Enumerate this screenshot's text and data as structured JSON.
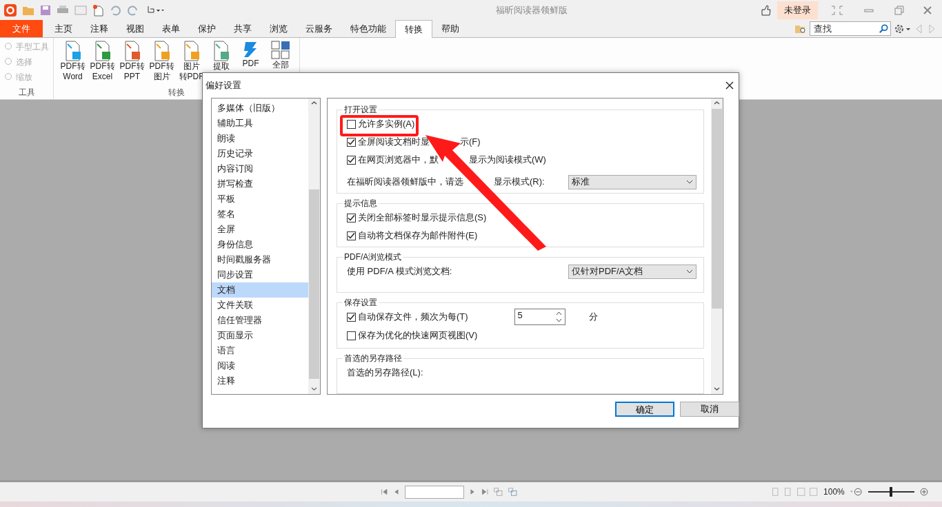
{
  "title_bar": {
    "title": "福昕阅读器领鲜版",
    "login": "未登录"
  },
  "menu_tabs": [
    {
      "label": "文件",
      "kind": "file",
      "selected": false
    },
    {
      "label": "主页",
      "kind": "tab",
      "selected": false
    },
    {
      "label": "注释",
      "kind": "tab",
      "selected": false
    },
    {
      "label": "视图",
      "kind": "tab",
      "selected": false
    },
    {
      "label": "表单",
      "kind": "tab",
      "selected": false
    },
    {
      "label": "保护",
      "kind": "tab",
      "selected": false
    },
    {
      "label": "共享",
      "kind": "tab",
      "selected": false
    },
    {
      "label": "浏览",
      "kind": "tab",
      "selected": false
    },
    {
      "label": "云服务",
      "kind": "tab",
      "selected": false
    },
    {
      "label": "特色功能",
      "kind": "tab",
      "selected": false
    },
    {
      "label": "转换",
      "kind": "tab",
      "selected": true
    },
    {
      "label": "帮助",
      "kind": "tab",
      "selected": false
    }
  ],
  "search": {
    "placeholder": "查找"
  },
  "ribbon": {
    "tools": {
      "label": "工具",
      "items": [
        {
          "label": "手型工具",
          "disabled": true
        },
        {
          "label": "选择",
          "disabled": true
        },
        {
          "label": "缩放",
          "disabled": true
        }
      ]
    },
    "convert": {
      "label": "转换",
      "items": [
        {
          "kind": "word",
          "lines": [
            "PDF转",
            "Word"
          ]
        },
        {
          "kind": "excel",
          "lines": [
            "PDF转",
            "Excel"
          ]
        },
        {
          "kind": "ppt",
          "lines": [
            "PDF转",
            "PPT"
          ]
        },
        {
          "kind": "image",
          "lines": [
            "PDF转",
            "图片"
          ]
        },
        {
          "kind": "topdf",
          "lines": [
            "图片",
            "转PDF"
          ]
        },
        {
          "kind": "extract",
          "lines": [
            "提取"
          ]
        },
        {
          "kind": "pdf",
          "lines": [
            "PDF"
          ]
        },
        {
          "kind": "all",
          "lines": [
            "全部"
          ]
        }
      ]
    }
  },
  "dialog": {
    "title": "偏好设置",
    "categories": [
      {
        "label": "多媒体（旧版）",
        "selected": false
      },
      {
        "label": "辅助工具",
        "selected": false
      },
      {
        "label": "朗读",
        "selected": false
      },
      {
        "label": "历史记录",
        "selected": false
      },
      {
        "label": "内容订阅",
        "selected": false
      },
      {
        "label": "拼写检查",
        "selected": false
      },
      {
        "label": "平板",
        "selected": false
      },
      {
        "label": "签名",
        "selected": false
      },
      {
        "label": "全屏",
        "selected": false
      },
      {
        "label": "身份信息",
        "selected": false
      },
      {
        "label": "时间戳服务器",
        "selected": false
      },
      {
        "label": "同步设置",
        "selected": false
      },
      {
        "label": "文档",
        "selected": true
      },
      {
        "label": "文件关联",
        "selected": false
      },
      {
        "label": "信任管理器",
        "selected": false
      },
      {
        "label": "页面显示",
        "selected": false
      },
      {
        "label": "语言",
        "selected": false
      },
      {
        "label": "阅读",
        "selected": false
      },
      {
        "label": "注释",
        "selected": false
      }
    ],
    "sections": [
      {
        "legend": "打开设置",
        "rows": [
          {
            "kind": "checkbox",
            "label": "允许多实例(A)",
            "checked": false,
            "highlighted": true
          },
          {
            "kind": "checkbox",
            "label_parts": [
              "全屏阅读文档时显",
              "示(F)"
            ],
            "checked": true
          },
          {
            "kind": "checkbox",
            "label_parts": [
              "在网页浏览器中，默",
              "显示为阅读模式(W)"
            ],
            "checked": true
          },
          {
            "kind": "select",
            "label_parts": [
              "在福昕阅读器领鲜版中，请选",
              "显示模式(R):"
            ],
            "value": "标准"
          }
        ]
      },
      {
        "legend": "提示信息",
        "rows": [
          {
            "kind": "checkbox",
            "label": "关闭全部标签时显示提示信息(S)",
            "checked": true
          },
          {
            "kind": "checkbox",
            "label": "自动将文档保存为邮件附件(E)",
            "checked": true
          }
        ]
      },
      {
        "legend": "PDF/A浏览模式",
        "rows": [
          {
            "kind": "select",
            "label": "使用 PDF/A 模式浏览文档:",
            "value": "仅针对PDF/A文档"
          }
        ]
      },
      {
        "legend": "保存设置",
        "rows": [
          {
            "kind": "spin",
            "label": "自动保存文件，频次为每(T)",
            "checked": true,
            "value": "5",
            "unit": "分"
          },
          {
            "kind": "checkbox",
            "label": "保存为优化的快速网页视图(V)",
            "checked": false
          }
        ]
      },
      {
        "legend": "首选的另存路径",
        "rows": [
          {
            "kind": "text",
            "label": "首选的另存路径(L):"
          }
        ]
      }
    ],
    "buttons": [
      {
        "label": "确定",
        "default": true
      },
      {
        "label": "取消",
        "default": false
      }
    ]
  },
  "status_bar": {
    "zoom": "100%",
    "zoom_slider": {
      "level": 0.5
    }
  }
}
